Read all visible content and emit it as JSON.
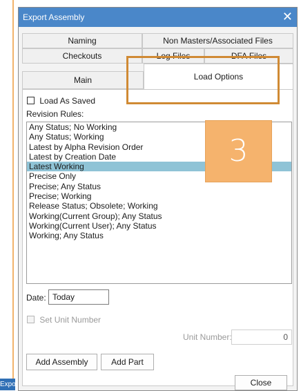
{
  "dialog": {
    "title": "Export Assembly",
    "close_glyph": "✕"
  },
  "tabs": {
    "naming": "Naming",
    "non_masters": "Non Masters/Associated Files",
    "checkouts": "Checkouts",
    "log_files": "Log Files",
    "dfa_files": "DFA Files",
    "main": "Main",
    "load_options": "Load Options"
  },
  "load_as_saved": {
    "label": "Load As Saved",
    "checked": false
  },
  "revision_rules": {
    "label": "Revision Rules:",
    "items": [
      "Any Status; No Working",
      "Any Status; Working",
      "Latest by Alpha Revision Order",
      "Latest by Creation Date",
      "Latest Working",
      "Precise Only",
      "Precise; Any Status",
      "Precise; Working",
      "Release Status; Obsolete; Working",
      "Working(Current Group); Any Status",
      "Working(Current User); Any Status",
      "Working; Any Status"
    ],
    "selected_index": 4
  },
  "date": {
    "label": "Date:",
    "value": "Today"
  },
  "set_unit_number": {
    "label": "Set Unit Number",
    "checked": false
  },
  "unit_number": {
    "label": "Unit Number:",
    "value": "0"
  },
  "buttons": {
    "add_assembly": "Add Assembly",
    "add_part": "Add Part",
    "close": "Close"
  },
  "annotation": {
    "step": "3"
  },
  "taskbar": {
    "label": "Expor"
  },
  "colors": {
    "titlebar": "#4a87c9",
    "selection": "#8fc3d6",
    "callout": "#d08a34",
    "badge": "#f5b36d"
  }
}
